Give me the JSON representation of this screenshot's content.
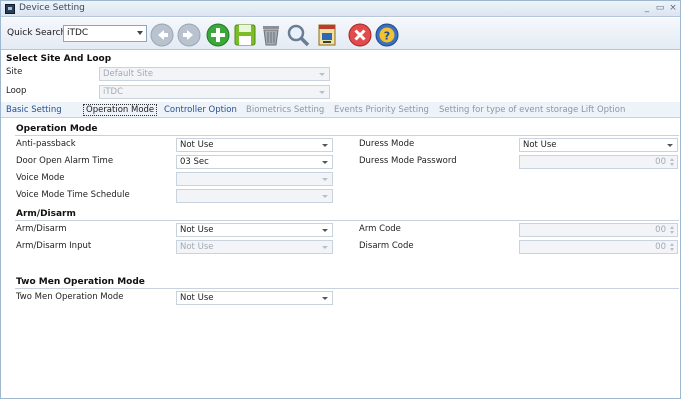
{
  "window": {
    "title": "Device Setting",
    "minimize_glyph": "_",
    "maximize_glyph": "▭",
    "close_glyph": "×"
  },
  "toolbar": {
    "quick_search_label": "Quick Search",
    "quick_search_value": "iTDC",
    "icons": [
      "back-arrow-icon",
      "forward-arrow-icon",
      "add-icon",
      "save-icon",
      "delete-icon",
      "search-icon",
      "report-icon",
      "cancel-icon",
      "help-icon"
    ]
  },
  "select_site_loop": {
    "heading": "Select Site And Loop",
    "site_label": "Site",
    "site_value": "Default Site",
    "loop_label": "Loop",
    "loop_value": "iTDC"
  },
  "tabs": [
    "Basic Setting",
    "Operation Mode",
    "Controller Option",
    "Biometrics Setting",
    "Events Priority Setting",
    "Setting for type of event storage",
    "Lift Option"
  ],
  "active_tab": "Operation Mode",
  "operation_mode": {
    "heading": "Operation Mode",
    "anti_passback_label": "Anti-passback",
    "anti_passback_value": "Not Use",
    "duress_mode_label": "Duress Mode",
    "duress_mode_value": "Not Use",
    "door_open_alarm_label": "Door Open Alarm Time",
    "door_open_alarm_value": "03 Sec",
    "duress_password_label": "Duress Mode Password",
    "duress_password_value": "00",
    "voice_mode_label": "Voice Mode",
    "voice_mode_value": "",
    "voice_schedule_label": "Voice Mode Time Schedule",
    "voice_schedule_value": ""
  },
  "arm_disarm": {
    "heading": "Arm/Disarm",
    "arm_disarm_label": "Arm/Disarm",
    "arm_disarm_value": "Not Use",
    "arm_code_label": "Arm Code",
    "arm_code_value": "00",
    "arm_disarm_input_label": "Arm/Disarm Input",
    "arm_disarm_input_value": "Not Use",
    "disarm_code_label": "Disarm Code",
    "disarm_code_value": "00"
  },
  "two_men": {
    "heading": "Two Men Operation Mode",
    "label": "Two Men Operation Mode",
    "value": "Not Use"
  }
}
